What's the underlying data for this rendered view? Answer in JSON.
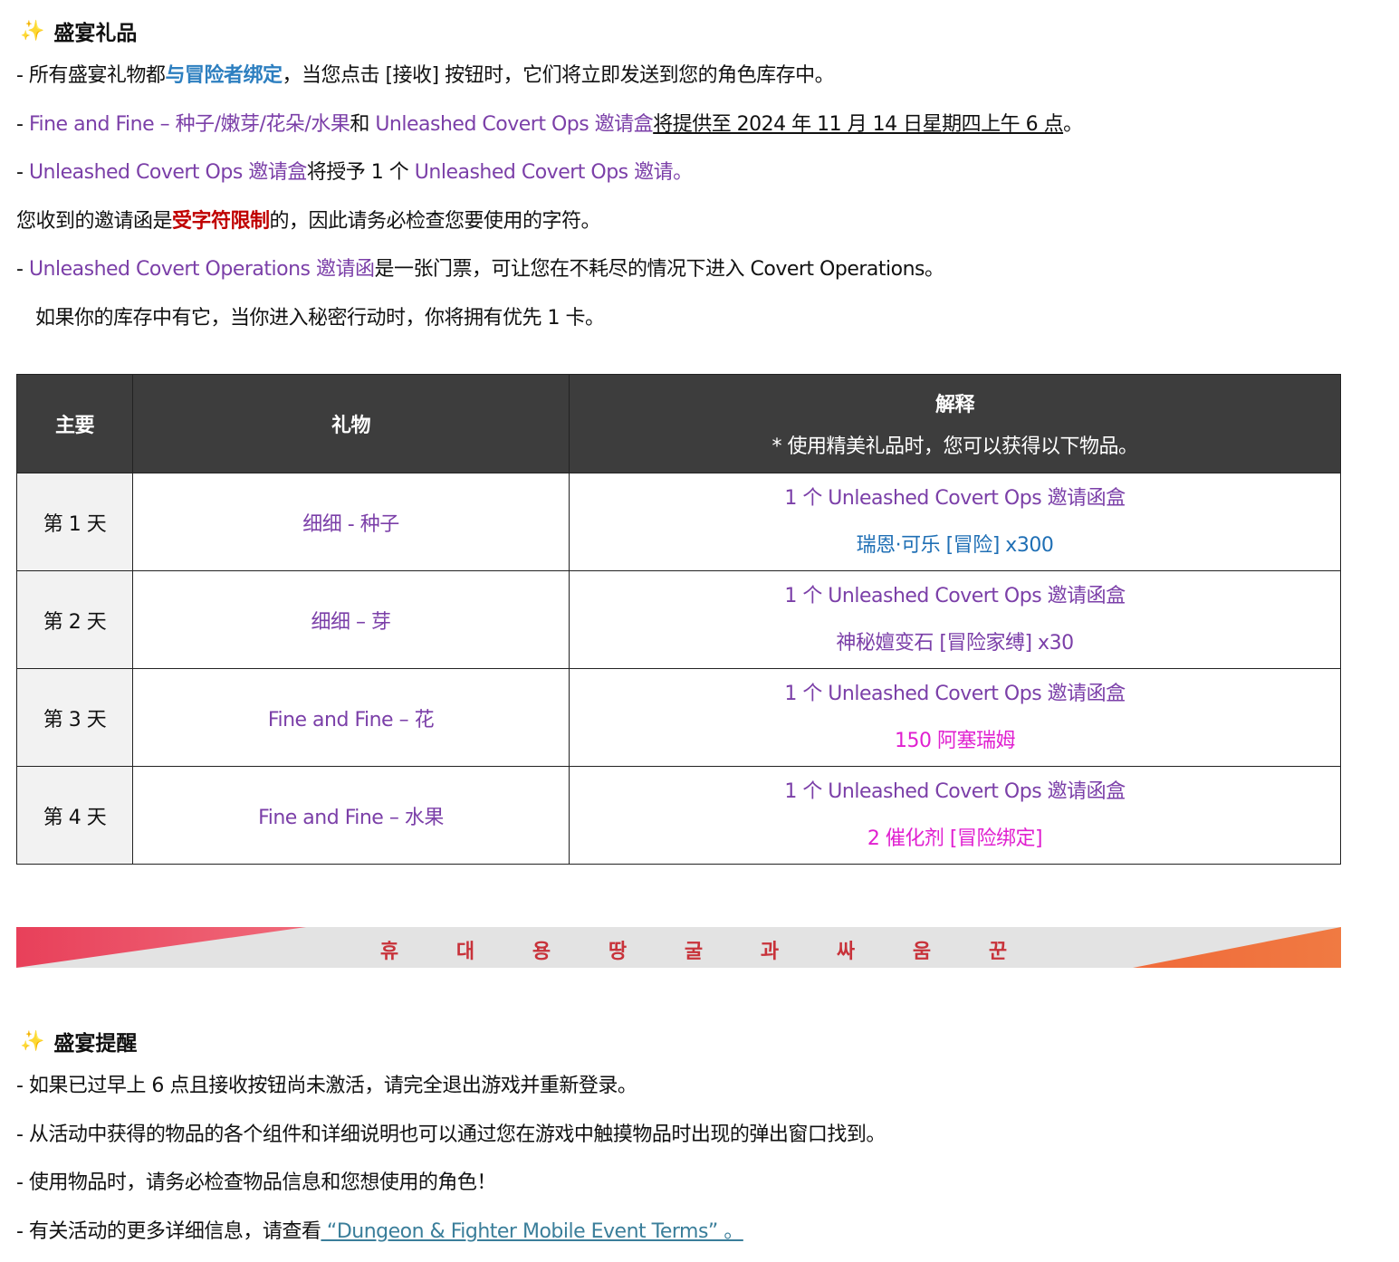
{
  "section1": {
    "icon": "sparkles-icon",
    "title": "盛宴礼品",
    "line1": {
      "a": "- 所有盛宴礼物都",
      "b": "与冒险者绑定",
      "c": "，当您点击 [接收] 按钮时，它们将立即发送到您的角色库存中。"
    },
    "line2": {
      "a": "- ",
      "b": "Fine and Fine – 种子/嫩芽/花朵/水果",
      "c": "和 ",
      "d": "Unleashed Covert Ops 邀请盒",
      "e": "将提供至 2024 年 11 月 14 日星期四上午 6 点",
      "f": "。"
    },
    "line3": {
      "a": "- ",
      "b": "Unleashed Covert Ops 邀请盒",
      "c": "将授予 1 个 ",
      "d": "Unleashed Covert Ops 邀请。"
    },
    "line4": {
      "a": "您收到的邀请函是",
      "b": "受字符限制",
      "c": "的，因此请务必检查您要使用的字符。"
    },
    "line5": {
      "a": "- ",
      "b": "Unleashed Covert Operations 邀请函",
      "c": "是一张门票，可让您在不耗尽的情况下进入 Covert Operations。"
    },
    "line6": "如果你的库存中有它，当你进入秘密行动时，你将拥有优先 1 卡。"
  },
  "table": {
    "headers": {
      "main": "主要",
      "gift": "礼物",
      "explain": "解释",
      "explain_sub": "* 使用精美礼品时，您可以获得以下物品。"
    },
    "rows": [
      {
        "day": "第 1 天",
        "gift": "细细 - 种子",
        "line1": "1 个 Unleashed Covert Ops 邀请函盒",
        "line2": "瑞恩·可乐 [冒险] x300",
        "line2_color": "#1f6fb5"
      },
      {
        "day": "第 2 天",
        "gift": "细细 – 芽",
        "line1": "1 个 Unleashed Covert Ops 邀请函盒",
        "line2": "神秘嬗变石 [冒险家缚] x30",
        "line2_color": "#7b3fa8"
      },
      {
        "day": "第 3 天",
        "gift": "Fine and Fine – 花",
        "line1": "1 个 Unleashed Covert Ops 邀请函盒",
        "line2": "150 阿塞瑞姆",
        "line2_color": "#e020d0"
      },
      {
        "day": "第 4 天",
        "gift": "Fine and Fine – 水果",
        "line1": "1 个 Unleashed Covert Ops 邀请函盒",
        "line2": "2 催化剂 [冒险绑定]",
        "line2_color": "#e020d0"
      }
    ]
  },
  "banner": {
    "chars": [
      "휴",
      "대",
      "용",
      "땅",
      "굴",
      "과",
      "싸",
      "움",
      "꾼"
    ]
  },
  "section2": {
    "icon": "sparkles-icon",
    "title": "盛宴提醒",
    "line1": "- 如果已过早上 6 点且接收按钮尚未激活，请完全退出游戏并重新登录。",
    "line2": "- 从活动中获得的物品的各个组件和详细说明也可以通过您在游戏中触摸物品时出现的弹出窗口找到。",
    "line3": "- 使用物品时，请务必检查物品信息和您想使用的角色！",
    "line4a": "- 有关活动的更多详细信息，请查看",
    "line4link": " “Dungeon & Fighter Mobile Event Terms”  。"
  }
}
